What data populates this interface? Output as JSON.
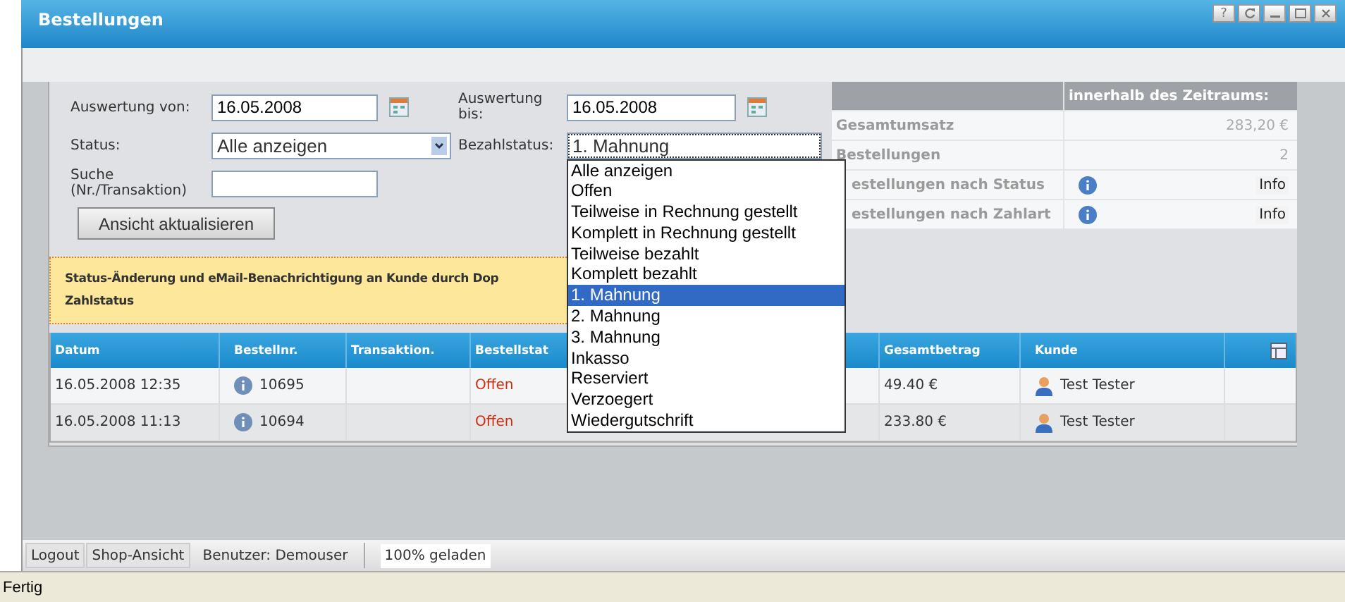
{
  "window": {
    "title": "Bestellungen",
    "help_label": "?"
  },
  "filter": {
    "from_label": "Auswertung von:",
    "from_value": "16.05.2008",
    "to_label": "Auswertung bis:",
    "to_value": "16.05.2008",
    "status_label": "Status:",
    "status_value": "Alle anzeigen",
    "pay_label": "Bezahlstatus:",
    "pay_value": "1. Mahnung",
    "search_label": "Suche (Nr./Transaktion)",
    "refresh_button": "Ansicht aktualisieren"
  },
  "pay_options": [
    {
      "label": "Alle anzeigen",
      "selected": false
    },
    {
      "label": "Offen",
      "selected": false
    },
    {
      "label": "Teilweise in Rechnung gestellt",
      "selected": false
    },
    {
      "label": "Komplett in Rechnung gestellt",
      "selected": false
    },
    {
      "label": "Teilweise bezahlt",
      "selected": false
    },
    {
      "label": "Komplett bezahlt",
      "selected": false
    },
    {
      "label": "1. Mahnung",
      "selected": true
    },
    {
      "label": "2. Mahnung",
      "selected": false
    },
    {
      "label": "3. Mahnung",
      "selected": false
    },
    {
      "label": "Inkasso",
      "selected": false
    },
    {
      "label": "Reserviert",
      "selected": false
    },
    {
      "label": "Verzoegert",
      "selected": false
    },
    {
      "label": "Wiedergutschrift",
      "selected": false
    }
  ],
  "notice": [
    "Status-Änderung und eMail-Benachrichtigung an Kunde durch Dop",
    "Zahlstatus"
  ],
  "stats": {
    "header": "innerhalb des Zeitraums:",
    "rows": [
      {
        "kind": "value",
        "label": "Gesamtumsatz",
        "value": "283,20 €"
      },
      {
        "kind": "value",
        "label": "Bestellungen",
        "value": "2"
      },
      {
        "kind": "info",
        "label": "estellungen nach Status",
        "value": "Info"
      },
      {
        "kind": "info",
        "label": "estellungen nach Zahlart",
        "value": "Info"
      }
    ]
  },
  "table": {
    "columns": [
      "Datum",
      "Bestellnr.",
      "Transaktion.",
      "Bestellstat",
      "Gesamtbetrag",
      "Kunde"
    ],
    "rows": [
      {
        "datum": "16.05.2008 12:35",
        "bestellnr": "10695",
        "bestellstatus": "Offen",
        "gesamtbetrag": "49.40 €",
        "kunde": "Test Tester"
      },
      {
        "datum": "16.05.2008 11:13",
        "bestellnr": "10694",
        "bestellstatus": "Offen",
        "gesamtbetrag": "233.80 €",
        "kunde": "Test Tester"
      }
    ]
  },
  "toolbar": {
    "buttons": [
      "Logout",
      "Shop-Ansicht"
    ],
    "user": "Benutzer: Demouser",
    "progress": "100% geladen"
  },
  "status_bar": "Fertig"
}
